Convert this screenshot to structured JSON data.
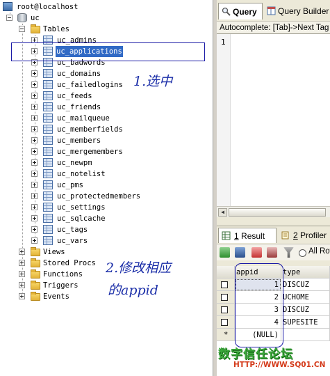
{
  "tree": {
    "root": "root@localhost",
    "database": "uc",
    "tables_folder": "Tables",
    "tables": [
      "uc_admins",
      "uc_applications",
      "uc_badwords",
      "uc_domains",
      "uc_failedlogins",
      "uc_feeds",
      "uc_friends",
      "uc_mailqueue",
      "uc_memberfields",
      "uc_members",
      "uc_mergemembers",
      "uc_newpm",
      "uc_notelist",
      "uc_pms",
      "uc_protectedmembers",
      "uc_settings",
      "uc_sqlcache",
      "uc_tags",
      "uc_vars"
    ],
    "selected_table": "uc_applications",
    "folders": [
      "Views",
      "Stored Procs",
      "Functions",
      "Triggers",
      "Events"
    ]
  },
  "annotations": {
    "step1": "1.选中",
    "step2_line1": "2.修改相应",
    "step2_line2": "的appid",
    "color": "#1b2ea8"
  },
  "editor": {
    "tabs": [
      "Query",
      "Query Builder"
    ],
    "autocomplete": "Autocomplete: [Tab]->Next Tag",
    "line_number": "1"
  },
  "results": {
    "tabs": [
      {
        "num": "1",
        "label": "Result"
      },
      {
        "num": "2",
        "label": "Profiler"
      }
    ],
    "all_rows_label": "All Rows",
    "columns": [
      "appid",
      "type"
    ],
    "rows": [
      {
        "appid": "1",
        "type": "DISCUZ"
      },
      {
        "appid": "2",
        "type": "UCHOME"
      },
      {
        "appid": "3",
        "type": "DISCUZ"
      },
      {
        "appid": "4",
        "type": "SUPESITE"
      }
    ],
    "new_row_marker": "*",
    "null_text": "(NULL)"
  },
  "watermark": {
    "title": "数字信任论坛",
    "url": "HTTP://WWW.SQ01.CN"
  },
  "colors": {
    "selection": "#316ac5",
    "annotation_box": "#1a1aa6",
    "panel": "#ece9d8"
  }
}
